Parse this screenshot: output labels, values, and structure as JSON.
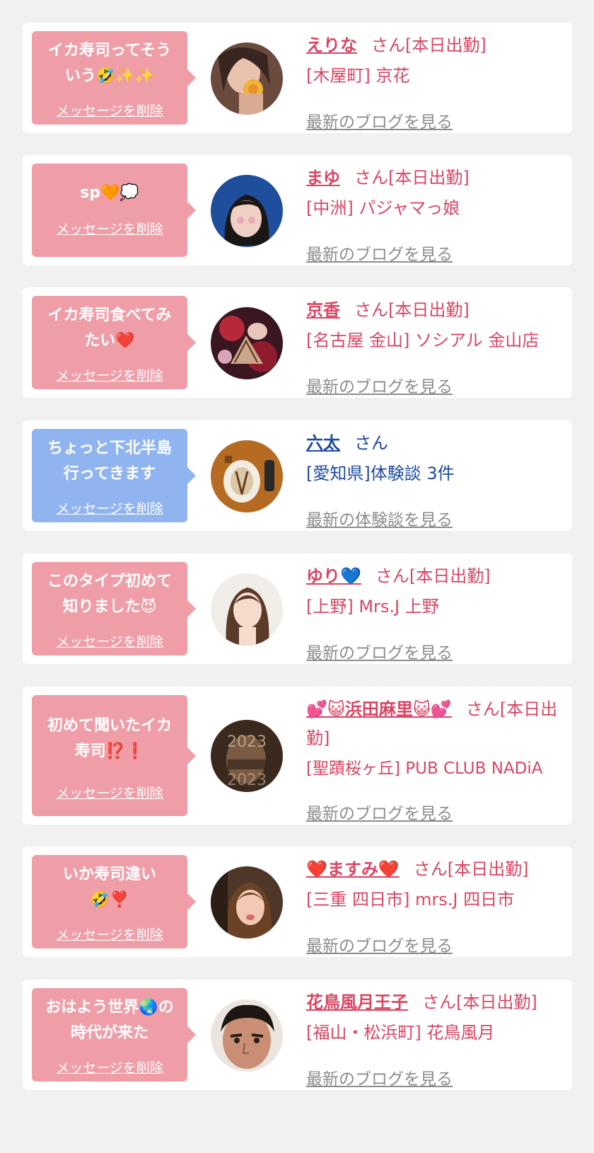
{
  "colors": {
    "background": "#f1f1f1",
    "card": "#ffffff",
    "pink_bubble": "#ef9ea8",
    "blue_bubble": "#90b4ef",
    "cast_text": "#d94663",
    "user_text": "#1f4aa0",
    "link_gray": "#8c8c8c"
  },
  "delete_label": "メッセージを削除",
  "items": [
    {
      "message": "イカ寿司ってそう\nいう🤣✨✨",
      "bubble": "pink",
      "name": "えりな",
      "suffix": "さん[本日出勤]",
      "shop": "[木屋町] 京花",
      "link": "最新のブログを見る",
      "avatar_icon": "woman-with-flower-photo"
    },
    {
      "message": "sp🧡💭",
      "bubble": "pink",
      "name": "まゆ",
      "suffix": "さん[本日出勤]",
      "shop": "[中洲] パジャマっ娘",
      "link": "最新のブログを見る",
      "avatar_icon": "woman-blue-background-photo"
    },
    {
      "message": "イカ寿司食べてみ\nたい❤️",
      "bubble": "pink",
      "name": "京香",
      "suffix": "さん[本日出勤]",
      "shop": "[名古屋 金山] ソシアル 金山店",
      "link": "最新のブログを見る",
      "avatar_icon": "kimono-fan-photo"
    },
    {
      "message": "ちょっと下北半島\n行ってきます",
      "bubble": "blue",
      "name": "六太",
      "suffix": "さん",
      "shop": "[愛知県]体験談 3件",
      "link": "最新の体験談を見る",
      "avatar_icon": "dinner-plate-photo"
    },
    {
      "message": "このタイプ初めて\n知りました😈",
      "bubble": "pink",
      "name": "ゆり💙",
      "suffix": "さん[本日出勤]",
      "shop": "[上野] Mrs.J 上野",
      "link": "最新のブログを見る",
      "avatar_icon": "woman-long-hair-photo"
    },
    {
      "message": "初めて聞いたイカ\n寿司⁉️❗",
      "bubble": "pink",
      "name": "💕😺浜田麻里😺💕",
      "suffix": "さん[本日出勤]",
      "shop": "[聖蹟桜ヶ丘] PUB CLUB NADiA",
      "link": "最新のブログを見る",
      "avatar_icon": "new-year-2023-photo"
    },
    {
      "message": "いか寿司違い\n🤣❣️",
      "bubble": "pink",
      "name": "❤️ますみ❤️",
      "suffix": "さん[本日出勤]",
      "shop": "[三重 四日市] mrs.J 四日市",
      "link": "最新のブログを見る",
      "avatar_icon": "woman-selfie-photo"
    },
    {
      "message": "おはよう世界🌏の\n時代が来た",
      "bubble": "pink",
      "name": "花鳥風月王子",
      "suffix": "さん[本日出勤]",
      "shop": "[福山・松浜町] 花鳥風月",
      "link": "最新のブログを見る",
      "avatar_icon": "man-face-photo"
    }
  ]
}
